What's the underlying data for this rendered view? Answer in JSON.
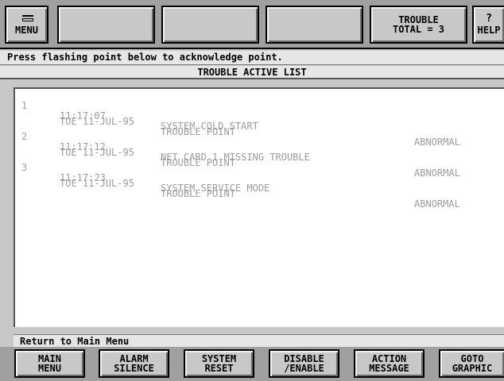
{
  "toolbar": {
    "menu_label": "MENU",
    "trouble_line1": "TROUBLE",
    "trouble_line2": "TOTAL = 3",
    "help_label": "HELP",
    "menu_icon": "menu-icon",
    "help_icon": "help-icon"
  },
  "instruction": "Press flashing point below to acknowledge point.",
  "list_title": "TROUBLE ACTIVE LIST",
  "entries": [
    {
      "num": "1",
      "time": "11:17:07",
      "description": "SYSTEM COLD START",
      "date": "TUE 11-JUL-95",
      "type": "TROUBLE POINT",
      "status": "ABNORMAL"
    },
    {
      "num": "2",
      "time": "11:17:12",
      "description": "NET CARD 1 MISSING TROUBLE",
      "date": "TUE 11-JUL-95",
      "type": "TROUBLE POINT",
      "status": "ABNORMAL"
    },
    {
      "num": "3",
      "time": "11:17:23",
      "description": "SYSTEM SERVICE MODE",
      "date": "TUE 11-JUL-95",
      "type": "TROUBLE POINT",
      "status": "ABNORMAL"
    }
  ],
  "status_line": "Return to Main Menu",
  "buttons": [
    {
      "line1": "MAIN",
      "line2": "MENU"
    },
    {
      "line1": "ALARM",
      "line2": "SILENCE"
    },
    {
      "line1": "SYSTEM",
      "line2": "RESET"
    },
    {
      "line1": "DISABLE",
      "line2": "/ENABLE"
    },
    {
      "line1": "ACTION",
      "line2": "MESSAGE"
    },
    {
      "line1": "GOTO",
      "line2": "GRAPHIC"
    }
  ],
  "colors": {
    "background": "#c8c8c8",
    "list_background": "#ffffff",
    "list_text": "#9c9c9c"
  }
}
